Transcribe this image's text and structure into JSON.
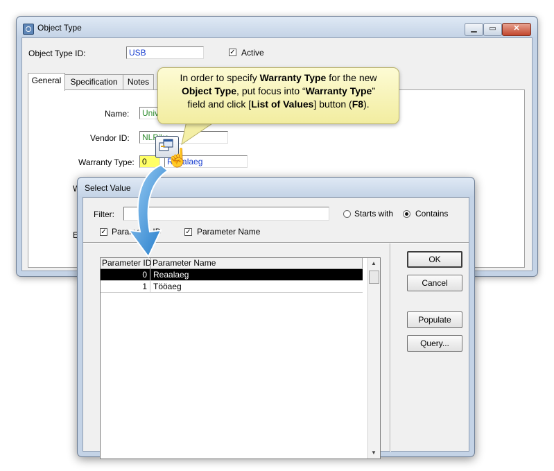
{
  "object_type_window": {
    "title": "Object Type",
    "object_type_id_label": "Object Type ID:",
    "object_type_id_value": "USB",
    "active_label": "Active",
    "active_checked": true,
    "tabs": [
      {
        "label": "General",
        "active": true
      },
      {
        "label": "Specification",
        "active": false
      },
      {
        "label": "Notes",
        "active": false
      }
    ],
    "name_label": "Name:",
    "name_value": "Univ",
    "vendor_id_label": "Vendor ID:",
    "vendor_id_value": "NLPike",
    "warranty_type_label": "Warranty Type:",
    "warranty_type_id": "0",
    "warranty_type_name": "Reaalaeg",
    "partial_label_w": "W",
    "partial_label_e": "E"
  },
  "callout": {
    "line1_pre": "In order to specify ",
    "line1_bold": "Warranty Type",
    "line1_post": " for the new",
    "line2_bold1": "Object Type",
    "line2_mid": ", put focus into “",
    "line2_bold2": "Warranty Type",
    "line2_post": "”",
    "line3_pre": "field and click [",
    "line3_bold1": "List of Values",
    "line3_mid": "] button (",
    "line3_bold2": "F8",
    "line3_post": ")."
  },
  "select_value_dialog": {
    "title": "Select Value",
    "filter_label": "Filter:",
    "filter_value": "",
    "starts_with_label": "Starts with",
    "contains_label": "Contains",
    "search_mode": "Contains",
    "param_id_checkbox_label": "Parameter ID",
    "param_name_checkbox_label": "Parameter Name",
    "columns": [
      "Parameter ID",
      "Parameter Name"
    ],
    "rows": [
      {
        "id": "0",
        "name": "Reaalaeg",
        "selected": true
      },
      {
        "id": "1",
        "name": "Tööaeg",
        "selected": false
      }
    ],
    "buttons": {
      "ok": "OK",
      "cancel": "Cancel",
      "populate": "Populate",
      "query": "Query..."
    }
  },
  "colors": {
    "callout_bg": "#fdfbd4",
    "arrow_blue": "#2f8fd8",
    "selected_row_bg": "#000000",
    "field_highlight": "#ffff66",
    "name_text": "#2e8b2e",
    "link_text": "#1a3fd0"
  }
}
